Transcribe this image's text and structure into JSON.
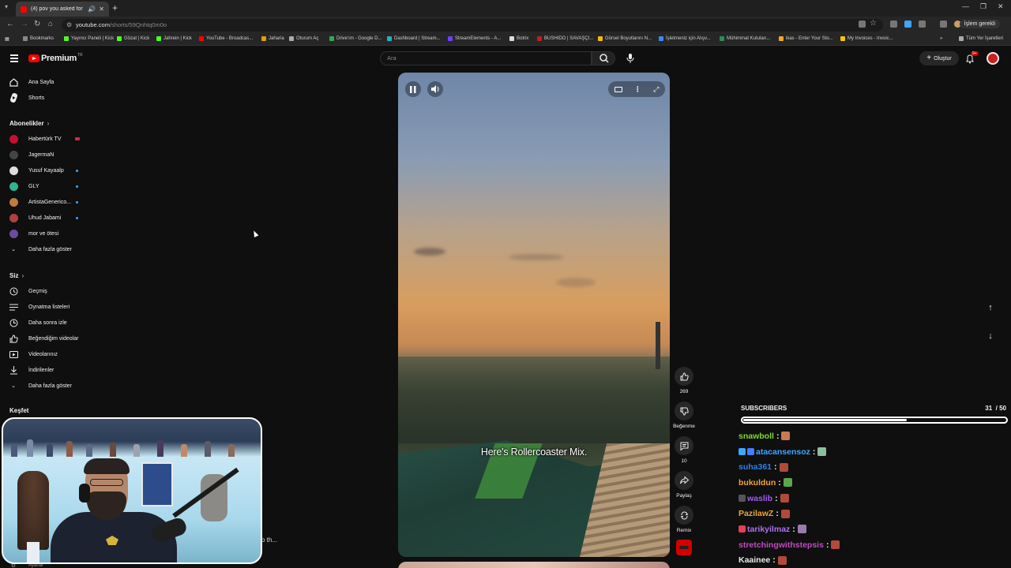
{
  "browser": {
    "tab_title": "(4) pov you asked for a vi...",
    "url_host": "youtube.com",
    "url_path": "/shorts/59Qnhtq0m0o",
    "profile_chip": "İşlem gerekli"
  },
  "bookmarks": [
    {
      "label": "Bookmarks",
      "color": "#888888"
    },
    {
      "label": "Yayıncı Paneli | Kick",
      "color": "#53fc18"
    },
    {
      "label": "Gözat | Kick",
      "color": "#53fc18"
    },
    {
      "label": "Jahrein | Kick",
      "color": "#53fc18"
    },
    {
      "label": "YouTube - Broadcas...",
      "color": "#ff0000"
    },
    {
      "label": "Jaharia",
      "color": "#e0a000"
    },
    {
      "label": "Oturum Aç",
      "color": "#aaaaaa"
    },
    {
      "label": "Drive'ım - Google D...",
      "color": "#34a853"
    },
    {
      "label": "Dashboard | Stream...",
      "color": "#1fb4c4"
    },
    {
      "label": "StreamElements - A...",
      "color": "#6f41ff"
    },
    {
      "label": "Botrix",
      "color": "#dddddd"
    },
    {
      "label": "BUSHIDO | SAVAŞÇI...",
      "color": "#c41e1e"
    },
    {
      "label": "Görsel Boyutlarını N...",
      "color": "#f0c000"
    },
    {
      "label": "İşletmeniz için Alışv...",
      "color": "#4285f4"
    },
    {
      "label": "Mühimmat Kutuları...",
      "color": "#2e8b57"
    },
    {
      "label": "ikas - Enter Your Sto...",
      "color": "#f5a623"
    },
    {
      "label": "My Invoices - Invoic...",
      "color": "#f7c500"
    }
  ],
  "bookmarks_other": "Tüm Yer İşaretleri",
  "header": {
    "logo_text": "Premium",
    "logo_region": "TR",
    "search_placeholder": "Ara",
    "create_label": "Oluştur",
    "notif_count": "9+"
  },
  "sidebar": {
    "home": "Ana Sayfa",
    "shorts": "Shorts",
    "subs_heading": "Abonelikler",
    "channels": [
      {
        "name": "Habertürk TV",
        "color": "#c8102e",
        "status": "live"
      },
      {
        "name": "JagermaN",
        "color": "#444444",
        "status": ""
      },
      {
        "name": "Yusuf Kayaalp",
        "color": "#dddddd",
        "status": "new"
      },
      {
        "name": "GLY",
        "color": "#2fb58f",
        "status": "new"
      },
      {
        "name": "ArtistaGenerico...",
        "color": "#c07a3a",
        "status": "new"
      },
      {
        "name": "Uhud Jabami",
        "color": "#b04040",
        "status": "new"
      },
      {
        "name": "mor ve ötesi",
        "color": "#6a4c9c",
        "status": ""
      }
    ],
    "show_more_1": "Daha fazla göster",
    "you_heading": "Siz",
    "you_items": [
      "Geçmiş",
      "Oynatma listeleri",
      "Daha sonra izle",
      "Beğendiğim videolar",
      "Videolarınız",
      "İndirilenler"
    ],
    "show_more_2": "Daha fazla göster",
    "explore_heading": "Keşfet",
    "bottom_partial": "Ayarlar"
  },
  "player": {
    "caption": "Here's Rollercoaster Mix."
  },
  "actions": {
    "like_count": "269",
    "dislike_label": "Beğenme",
    "comment_count": "10",
    "share_label": "Paylaş",
    "remix_label": "Remix"
  },
  "behind_overlay_text": "o th...",
  "subscribers": {
    "title": "SUBSCRIBERS",
    "count": "31",
    "goal": "/ 50",
    "progress": 0.62
  },
  "chat": [
    {
      "user": "snawboll",
      "color": "#7fd63a",
      "emote": "#c97a52",
      "badges": []
    },
    {
      "user": "atacansensoz",
      "color": "#3ea6ff",
      "emote": "#8bbf9f",
      "badges": [
        "#3ea6ff",
        "#4a7cff"
      ]
    },
    {
      "user": "suha361",
      "color": "#2f7fe8",
      "emote": "#b04a3a",
      "badges": []
    },
    {
      "user": "bukuldun",
      "color": "#f0a43a",
      "emote": "#5aa84a",
      "badges": []
    },
    {
      "user": "waslib",
      "color": "#a25cf0",
      "emote": "#b04a3a",
      "badges": [
        "#555555"
      ]
    },
    {
      "user": "PazilawZ",
      "color": "#f0a43a",
      "emote": "#b04a3a",
      "badges": []
    },
    {
      "user": "tarikyilmaz",
      "color": "#b070f0",
      "emote": "#9a7ab0",
      "badges": [
        "#e0405a"
      ]
    },
    {
      "user": "stretchingwithstepsis",
      "color": "#c24ac2",
      "emote": "#b04a3a",
      "badges": []
    },
    {
      "user": "Kaainee",
      "color": "#e8e8e8",
      "emote": "#b04a3a",
      "badges": []
    }
  ]
}
